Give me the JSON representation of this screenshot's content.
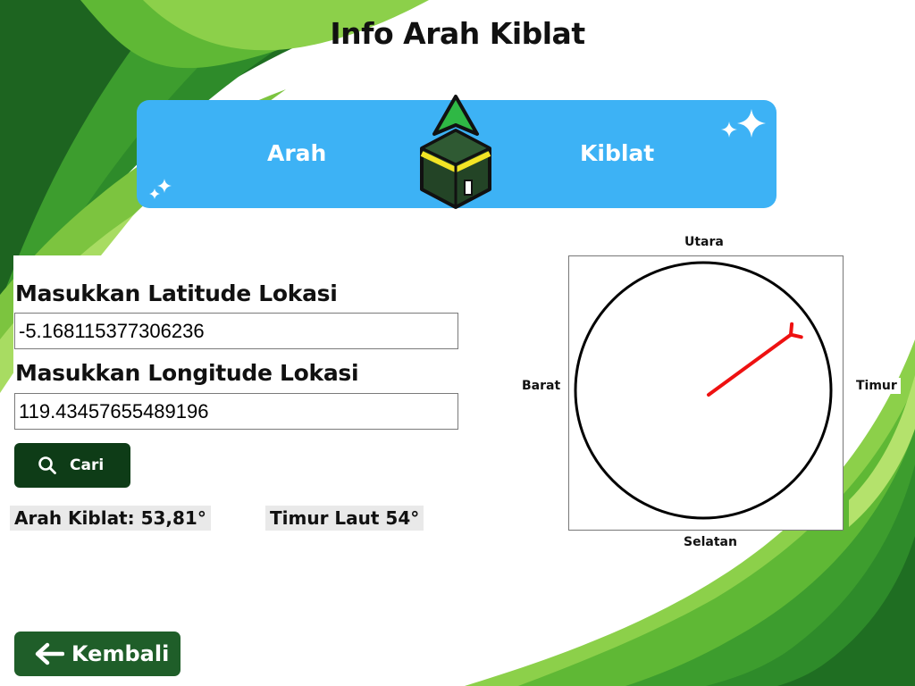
{
  "page": {
    "title": "Info Arah Kiblat"
  },
  "banner": {
    "left_text": "Arah",
    "right_text": "Kiblat"
  },
  "form": {
    "latitude_label": "Masukkan Latitude Lokasi",
    "latitude_value": "-5.168115377306236",
    "longitude_label": "Masukkan Longitude Lokasi",
    "longitude_value": "119.43457655489196",
    "search_button": "Cari"
  },
  "result": {
    "qibla_text": "Arah Kiblat: 53,81°",
    "direction_text": "Timur Laut 54°",
    "qibla_degrees": 53.81
  },
  "compass": {
    "north": "Utara",
    "south": "Selatan",
    "east": "Timur",
    "west": "Barat",
    "needle_color": "#ee1111"
  },
  "nav": {
    "back_button": "Kembali"
  },
  "icons": {
    "search": "search-icon",
    "back": "arrow-left-icon",
    "kaaba": "kaaba-icon",
    "sparkle": "sparkle-icon"
  },
  "colors": {
    "primary_dark": "#0e3c17",
    "back_button": "#1f5e29",
    "banner": "#3db2f5",
    "leaf_green": "#4b9e2c"
  }
}
